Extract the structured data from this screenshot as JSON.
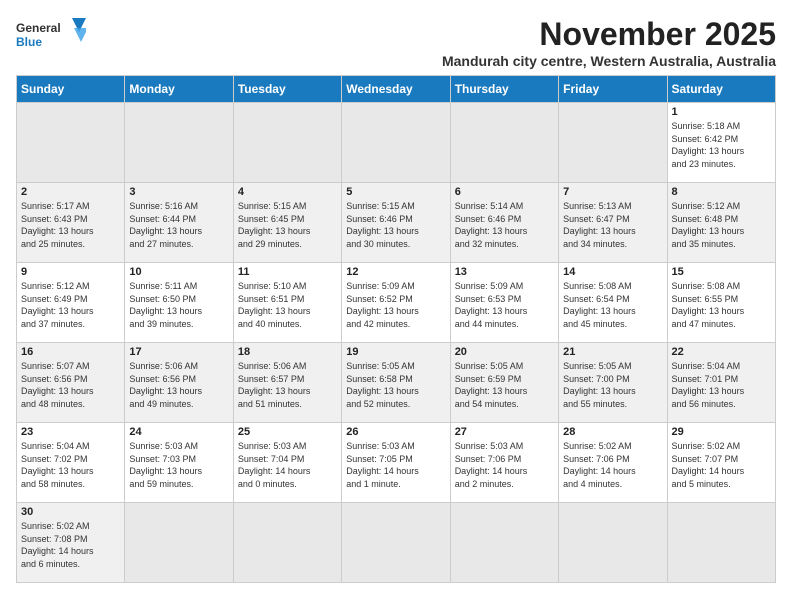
{
  "header": {
    "logo_general": "General",
    "logo_blue": "Blue",
    "month_title": "November 2025",
    "location": "Mandurah city centre, Western Australia, Australia"
  },
  "weekdays": [
    "Sunday",
    "Monday",
    "Tuesday",
    "Wednesday",
    "Thursday",
    "Friday",
    "Saturday"
  ],
  "weeks": [
    [
      {
        "day": "",
        "info": ""
      },
      {
        "day": "",
        "info": ""
      },
      {
        "day": "",
        "info": ""
      },
      {
        "day": "",
        "info": ""
      },
      {
        "day": "",
        "info": ""
      },
      {
        "day": "",
        "info": ""
      },
      {
        "day": "1",
        "info": "Sunrise: 5:18 AM\nSunset: 6:42 PM\nDaylight: 13 hours\nand 23 minutes."
      }
    ],
    [
      {
        "day": "2",
        "info": "Sunrise: 5:17 AM\nSunset: 6:43 PM\nDaylight: 13 hours\nand 25 minutes."
      },
      {
        "day": "3",
        "info": "Sunrise: 5:16 AM\nSunset: 6:44 PM\nDaylight: 13 hours\nand 27 minutes."
      },
      {
        "day": "4",
        "info": "Sunrise: 5:15 AM\nSunset: 6:45 PM\nDaylight: 13 hours\nand 29 minutes."
      },
      {
        "day": "5",
        "info": "Sunrise: 5:15 AM\nSunset: 6:46 PM\nDaylight: 13 hours\nand 30 minutes."
      },
      {
        "day": "6",
        "info": "Sunrise: 5:14 AM\nSunset: 6:46 PM\nDaylight: 13 hours\nand 32 minutes."
      },
      {
        "day": "7",
        "info": "Sunrise: 5:13 AM\nSunset: 6:47 PM\nDaylight: 13 hours\nand 34 minutes."
      },
      {
        "day": "8",
        "info": "Sunrise: 5:12 AM\nSunset: 6:48 PM\nDaylight: 13 hours\nand 35 minutes."
      }
    ],
    [
      {
        "day": "9",
        "info": "Sunrise: 5:12 AM\nSunset: 6:49 PM\nDaylight: 13 hours\nand 37 minutes."
      },
      {
        "day": "10",
        "info": "Sunrise: 5:11 AM\nSunset: 6:50 PM\nDaylight: 13 hours\nand 39 minutes."
      },
      {
        "day": "11",
        "info": "Sunrise: 5:10 AM\nSunset: 6:51 PM\nDaylight: 13 hours\nand 40 minutes."
      },
      {
        "day": "12",
        "info": "Sunrise: 5:09 AM\nSunset: 6:52 PM\nDaylight: 13 hours\nand 42 minutes."
      },
      {
        "day": "13",
        "info": "Sunrise: 5:09 AM\nSunset: 6:53 PM\nDaylight: 13 hours\nand 44 minutes."
      },
      {
        "day": "14",
        "info": "Sunrise: 5:08 AM\nSunset: 6:54 PM\nDaylight: 13 hours\nand 45 minutes."
      },
      {
        "day": "15",
        "info": "Sunrise: 5:08 AM\nSunset: 6:55 PM\nDaylight: 13 hours\nand 47 minutes."
      }
    ],
    [
      {
        "day": "16",
        "info": "Sunrise: 5:07 AM\nSunset: 6:56 PM\nDaylight: 13 hours\nand 48 minutes."
      },
      {
        "day": "17",
        "info": "Sunrise: 5:06 AM\nSunset: 6:56 PM\nDaylight: 13 hours\nand 49 minutes."
      },
      {
        "day": "18",
        "info": "Sunrise: 5:06 AM\nSunset: 6:57 PM\nDaylight: 13 hours\nand 51 minutes."
      },
      {
        "day": "19",
        "info": "Sunrise: 5:05 AM\nSunset: 6:58 PM\nDaylight: 13 hours\nand 52 minutes."
      },
      {
        "day": "20",
        "info": "Sunrise: 5:05 AM\nSunset: 6:59 PM\nDaylight: 13 hours\nand 54 minutes."
      },
      {
        "day": "21",
        "info": "Sunrise: 5:05 AM\nSunset: 7:00 PM\nDaylight: 13 hours\nand 55 minutes."
      },
      {
        "day": "22",
        "info": "Sunrise: 5:04 AM\nSunset: 7:01 PM\nDaylight: 13 hours\nand 56 minutes."
      }
    ],
    [
      {
        "day": "23",
        "info": "Sunrise: 5:04 AM\nSunset: 7:02 PM\nDaylight: 13 hours\nand 58 minutes."
      },
      {
        "day": "24",
        "info": "Sunrise: 5:03 AM\nSunset: 7:03 PM\nDaylight: 13 hours\nand 59 minutes."
      },
      {
        "day": "25",
        "info": "Sunrise: 5:03 AM\nSunset: 7:04 PM\nDaylight: 14 hours\nand 0 minutes."
      },
      {
        "day": "26",
        "info": "Sunrise: 5:03 AM\nSunset: 7:05 PM\nDaylight: 14 hours\nand 1 minute."
      },
      {
        "day": "27",
        "info": "Sunrise: 5:03 AM\nSunset: 7:06 PM\nDaylight: 14 hours\nand 2 minutes."
      },
      {
        "day": "28",
        "info": "Sunrise: 5:02 AM\nSunset: 7:06 PM\nDaylight: 14 hours\nand 4 minutes."
      },
      {
        "day": "29",
        "info": "Sunrise: 5:02 AM\nSunset: 7:07 PM\nDaylight: 14 hours\nand 5 minutes."
      }
    ],
    [
      {
        "day": "30",
        "info": "Sunrise: 5:02 AM\nSunset: 7:08 PM\nDaylight: 14 hours\nand 6 minutes."
      },
      {
        "day": "",
        "info": ""
      },
      {
        "day": "",
        "info": ""
      },
      {
        "day": "",
        "info": ""
      },
      {
        "day": "",
        "info": ""
      },
      {
        "day": "",
        "info": ""
      },
      {
        "day": "",
        "info": ""
      }
    ]
  ]
}
